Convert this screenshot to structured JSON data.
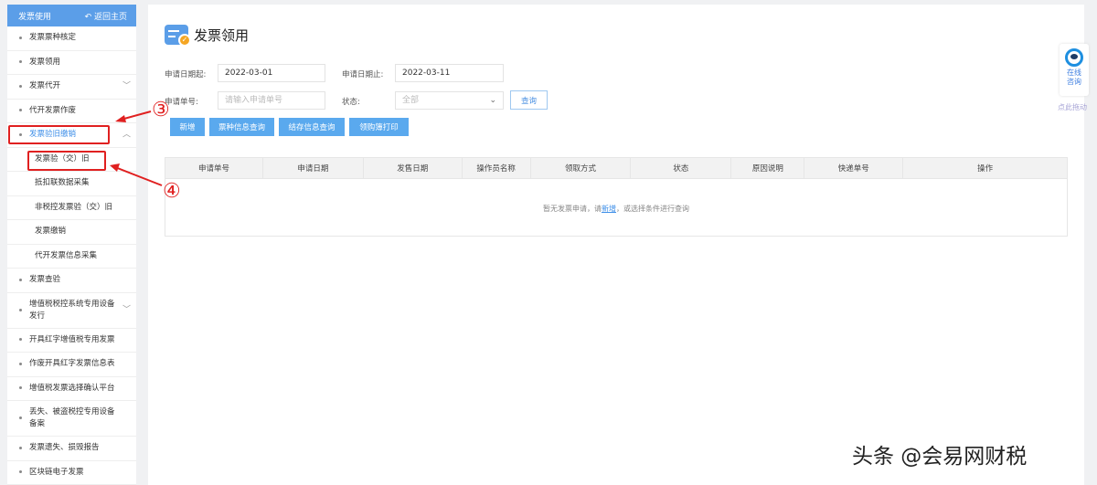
{
  "sidebar": {
    "title": "发票使用",
    "back_label": "返回主页",
    "items": [
      {
        "label": "发票票种核定"
      },
      {
        "label": "发票领用"
      },
      {
        "label": "发票代开",
        "chevron": "down"
      },
      {
        "label": "代开发票作废"
      },
      {
        "label": "发票验旧缴销",
        "chevron": "up",
        "active": true
      },
      {
        "label": "发票验（交）旧",
        "sub": true
      },
      {
        "label": "抵扣联数据采集",
        "sub": true
      },
      {
        "label": "非税控发票验（交）旧",
        "sub": true
      },
      {
        "label": "发票缴销",
        "sub": true
      },
      {
        "label": "代开发票信息采集",
        "sub": true
      },
      {
        "label": "发票查验"
      },
      {
        "label": "增值税税控系统专用设备发行",
        "chevron": "down",
        "two": true
      },
      {
        "label": "开具红字增值税专用发票"
      },
      {
        "label": "作废开具红字发票信息表"
      },
      {
        "label": "增值税发票选择确认平台"
      },
      {
        "label": "丢失、被盗税控专用设备备案",
        "two": true
      },
      {
        "label": "发票遗失、损毁报告"
      },
      {
        "label": "区块链电子发票"
      }
    ]
  },
  "page": {
    "title": "发票领用"
  },
  "form": {
    "start_label": "申请日期起:",
    "start_value": "2022-03-01",
    "end_label": "申请日期止:",
    "end_value": "2022-03-11",
    "number_label": "申请单号:",
    "number_placeholder": "请输入申请单号",
    "status_label": "状态:",
    "status_value": "全部",
    "query": "查询"
  },
  "buttons": [
    "新增",
    "票种信息查询",
    "结存信息查询",
    "领购簿打印"
  ],
  "table": {
    "columns": [
      "申请单号",
      "申请日期",
      "发售日期",
      "操作员名称",
      "领取方式",
      "状态",
      "原因说明",
      "快递单号",
      "操作"
    ],
    "empty_pre": "暂无发票申请，请",
    "empty_link": "新增",
    "empty_post": "，或选择条件进行查询"
  },
  "float": {
    "line1": "在线",
    "line2": "咨询",
    "drag": "点此拖动"
  },
  "annotations": {
    "three": "③",
    "four": "④"
  },
  "watermark": "头条 @会易网财税",
  "colors": {
    "accent": "#5b9ee8",
    "annotation": "#e02020"
  }
}
